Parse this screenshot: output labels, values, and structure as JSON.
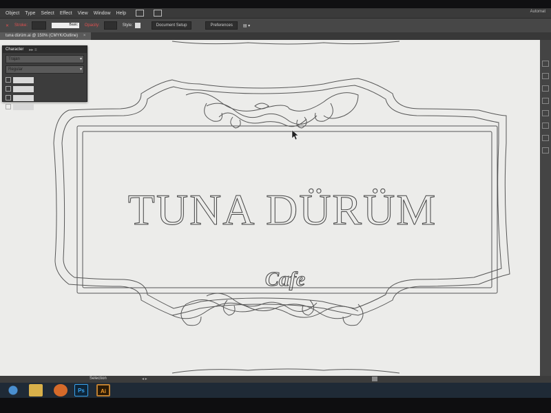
{
  "menubar": {
    "items": [
      "Object",
      "Type",
      "Select",
      "Effect",
      "View",
      "Window",
      "Help"
    ],
    "workspace": "Automat"
  },
  "controlbar": {
    "stroke_label": "Stroke:",
    "stroke_profile": "Basic",
    "opacity_label": "Opacity:",
    "style_label": "Style:",
    "document_setup": "Document Setup",
    "preferences": "Preferences"
  },
  "document_tab": {
    "title": "tuna dürüm.ai @ 150% (CMYK/Outline)"
  },
  "character_panel": {
    "title": "Character",
    "font_family": "Trajan",
    "font_style": "Regular",
    "fields": [
      "",
      "",
      "",
      ""
    ]
  },
  "artwork": {
    "title": "TUNA DÜRÜM",
    "subtitle": "Cafe"
  },
  "statusbar": {
    "mode": "Selection"
  },
  "taskbar": {
    "apps": [
      "start",
      "folder",
      "firefox",
      "Ps",
      "Ai"
    ]
  },
  "colors": {
    "canvas": "#ececea",
    "ui_dark": "#3c3c3c",
    "outline_stroke": "#555555"
  }
}
